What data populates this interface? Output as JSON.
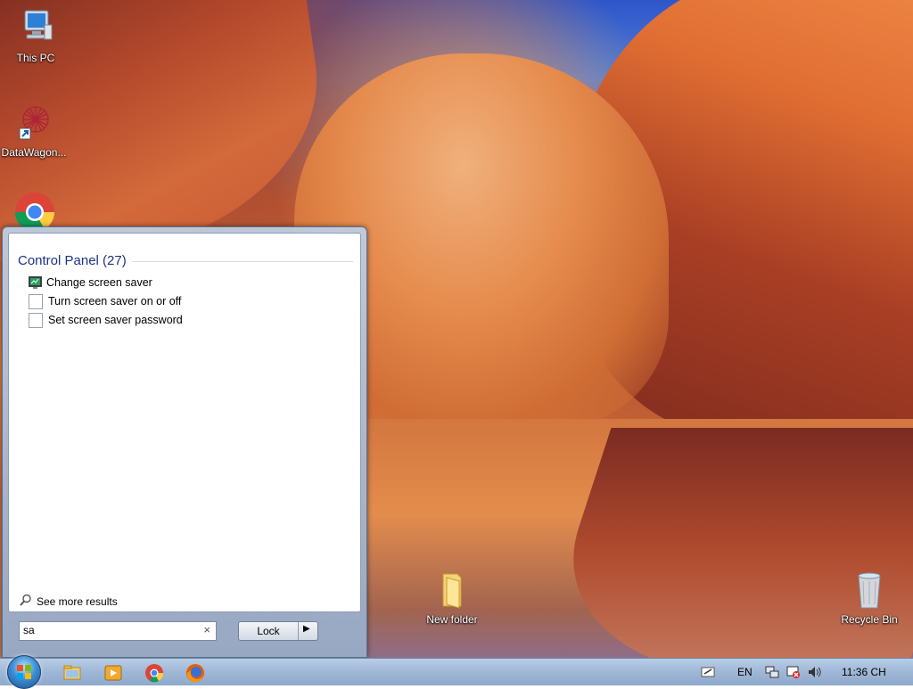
{
  "desktop": {
    "icons": [
      {
        "label": "This PC"
      },
      {
        "label": "DataWagon..."
      },
      {
        "label": "Google Chrome"
      },
      {
        "label": "New folder"
      },
      {
        "label": "Recycle Bin"
      }
    ]
  },
  "start_menu": {
    "group_title": "Control Panel (27)",
    "results": [
      {
        "label": "Change screen saver",
        "icon": "monitor-icon"
      },
      {
        "label": "Turn screen saver on or off",
        "icon": "document-icon"
      },
      {
        "label": "Set screen saver password",
        "icon": "document-icon"
      }
    ],
    "see_more": "See more results",
    "search_value": "sa",
    "lock_label": "Lock"
  },
  "taskbar": {
    "apps": [
      "file-explorer-icon",
      "media-player-icon",
      "chrome-icon",
      "firefox-icon"
    ],
    "language": "EN",
    "clock": "11:36 CH"
  }
}
